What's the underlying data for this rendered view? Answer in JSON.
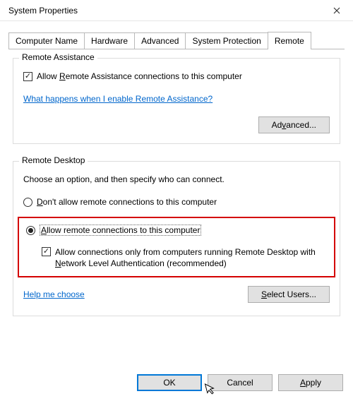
{
  "window": {
    "title": "System Properties",
    "close_tooltip": "Close"
  },
  "tabs": {
    "computer_name": "Computer Name",
    "hardware": "Hardware",
    "advanced": "Advanced",
    "system_protection": "System Protection",
    "remote": "Remote"
  },
  "remote_assistance": {
    "legend": "Remote Assistance",
    "allow_label_pre": "Allow ",
    "allow_label_key": "R",
    "allow_label_post": "emote Assistance connections to this computer",
    "whatsnew_link": "What happens when I enable Remote Assistance?",
    "advanced_btn_pre": "Ad",
    "advanced_btn_key": "v",
    "advanced_btn_post": "anced..."
  },
  "remote_desktop": {
    "legend": "Remote Desktop",
    "instruction": "Choose an option, and then specify who can connect.",
    "opt_dont_pre": "D",
    "opt_dont_post": "on't allow remote connections to this computer",
    "opt_allow_pre": "A",
    "opt_allow_post": "llow remote connections to this computer",
    "nla_pre": "Allow connections only from computers running Remote Desktop with ",
    "nla_key": "N",
    "nla_post": "etwork Level Authentication (recommended)",
    "help_link": "Help me choose",
    "select_users_pre": "S",
    "select_users_post": "elect Users..."
  },
  "buttons": {
    "ok": "OK",
    "cancel": "Cancel",
    "apply_pre": "A",
    "apply_post": "pply"
  }
}
